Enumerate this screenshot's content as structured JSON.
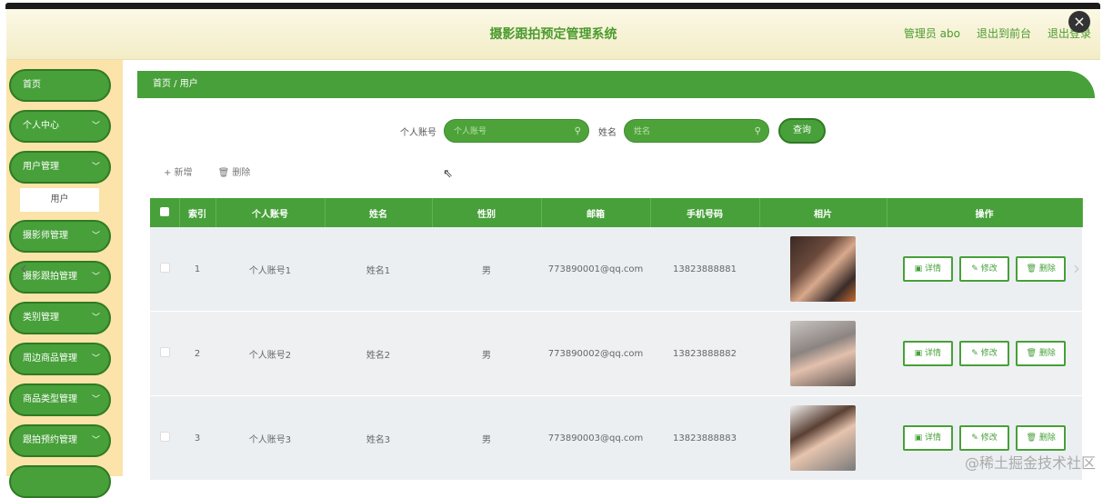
{
  "header": {
    "title": "摄影跟拍预定管理系统",
    "admin": "管理员 abo",
    "exit_front": "退出到前台",
    "logout": "退出登录"
  },
  "sidebar": {
    "items": [
      {
        "label": "首页",
        "chevron": false
      },
      {
        "label": "个人中心",
        "chevron": true
      },
      {
        "label": "用户管理",
        "chevron": true
      },
      {
        "label": "摄影师管理",
        "chevron": true
      },
      {
        "label": "摄影跟拍管理",
        "chevron": true
      },
      {
        "label": "类别管理",
        "chevron": true
      },
      {
        "label": "周边商品管理",
        "chevron": true
      },
      {
        "label": "商品类型管理",
        "chevron": true
      },
      {
        "label": "跟拍预约管理",
        "chevron": true
      }
    ],
    "submenu": "用户"
  },
  "breadcrumb": "首页 / 用户",
  "search": {
    "account_label": "个人账号",
    "account_placeholder": "个人账号",
    "name_label": "姓名",
    "name_placeholder": "姓名",
    "query_button": "查询"
  },
  "actions": {
    "add": "+ 新增",
    "delete": "🗑 删除"
  },
  "table": {
    "headers": [
      "",
      "索引",
      "个人账号",
      "姓名",
      "性别",
      "邮箱",
      "手机号码",
      "相片",
      "操作"
    ],
    "rows": [
      {
        "index": "1",
        "account": "个人账号1",
        "name": "姓名1",
        "gender": "男",
        "email": "773890001@qq.com",
        "phone": "13823888881"
      },
      {
        "index": "2",
        "account": "个人账号2",
        "name": "姓名2",
        "gender": "男",
        "email": "773890002@qq.com",
        "phone": "13823888882"
      },
      {
        "index": "3",
        "account": "个人账号3",
        "name": "姓名3",
        "gender": "男",
        "email": "773890003@qq.com",
        "phone": "13823888883"
      }
    ],
    "ops": {
      "detail": "详情",
      "edit": "修改",
      "delete": "删除"
    }
  },
  "watermark": "@稀土掘金技术社区",
  "colors": {
    "primary_green": "#47a039",
    "sidebar_bg": "#fbe3a9"
  }
}
